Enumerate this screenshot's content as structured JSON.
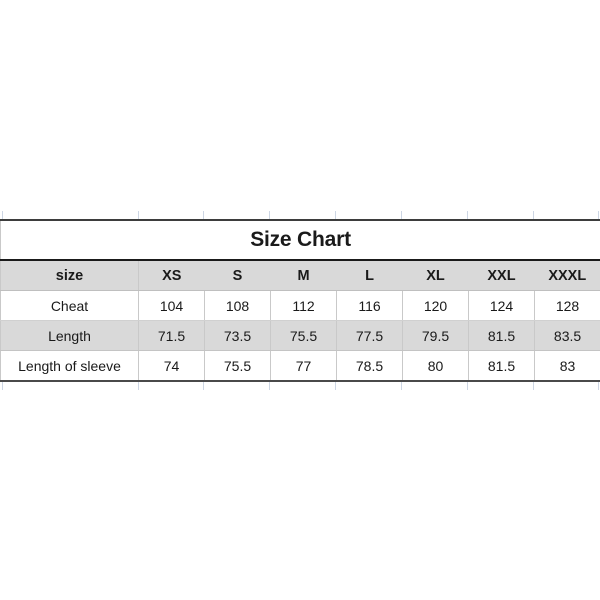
{
  "title": "Size Chart",
  "table": {
    "columns": [
      "size",
      "XS",
      "S",
      "M",
      "L",
      "XL",
      "XXL",
      "XXXL"
    ],
    "rows": [
      {
        "label": "Cheat",
        "values": [
          "104",
          "108",
          "112",
          "116",
          "120",
          "124",
          "128"
        ]
      },
      {
        "label": "Length",
        "values": [
          "71.5",
          "73.5",
          "75.5",
          "77.5",
          "79.5",
          "81.5",
          "83.5"
        ]
      },
      {
        "label": "Length of sleeve",
        "values": [
          "74",
          "75.5",
          "77",
          "78.5",
          "80",
          "81.5",
          "83"
        ]
      }
    ]
  },
  "colors": {
    "header_fill": "#d9d9d9",
    "stripe_fill": "#d9d9d9",
    "cell_fill": "#ffffff",
    "rule": "#1a1a1a",
    "grid": "#c9c9c9",
    "tick": "#cdd6e4",
    "text": "#1a1a1a",
    "background": "#ffffff"
  },
  "chart_data": {
    "type": "table",
    "title": "Size Chart",
    "xlabel": "",
    "ylabel": "",
    "categories": [
      "XS",
      "S",
      "M",
      "L",
      "XL",
      "XXL",
      "XXXL"
    ],
    "series": [
      {
        "name": "Cheat",
        "values": [
          104,
          108,
          112,
          116,
          120,
          124,
          128
        ]
      },
      {
        "name": "Length",
        "values": [
          71.5,
          73.5,
          75.5,
          77.5,
          79.5,
          81.5,
          83.5
        ]
      },
      {
        "name": "Length of sleeve",
        "values": [
          74,
          75.5,
          77,
          78.5,
          80,
          81.5,
          83
        ]
      }
    ]
  }
}
